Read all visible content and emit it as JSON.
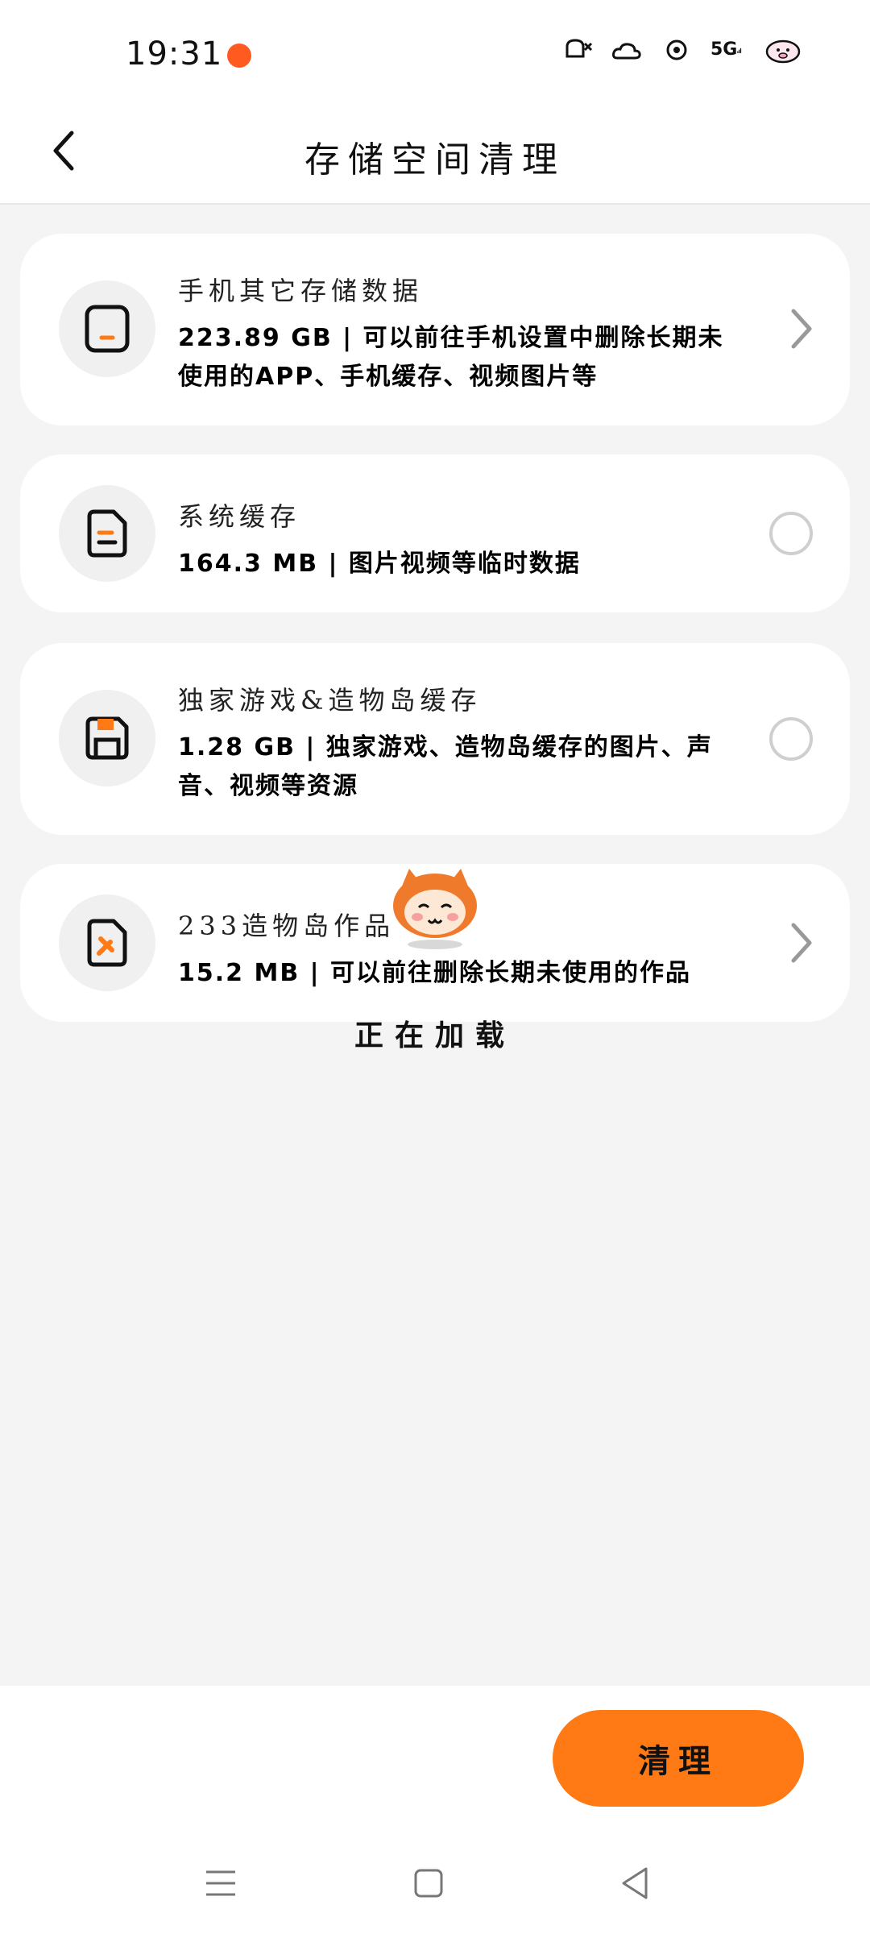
{
  "status_bar": {
    "time": "19:31",
    "network": "5G",
    "icons": [
      "notification-app-icon",
      "mute-icon",
      "weather-icon",
      "settings-icon",
      "signal-icon",
      "battery-pig-icon"
    ]
  },
  "header": {
    "title": "存储空间清理",
    "back_icon": "chevron-left-icon"
  },
  "items": [
    {
      "title": "手机其它存储数据",
      "description": "223.89 GB | 可以前往手机设置中删除长期未使用的APP、手机缓存、视频图片等",
      "icon": "phone-icon",
      "control": "chevron"
    },
    {
      "title": "系统缓存",
      "description": "164.3 MB | 图片视频等临时数据",
      "icon": "document-icon",
      "control": "radio"
    },
    {
      "title": "独家游戏&造物岛缓存",
      "description": "1.28 GB | 独家游戏、造物岛缓存的图片、声音、视频等资源",
      "icon": "save-disk-icon",
      "control": "radio"
    },
    {
      "title": "233造物岛作品",
      "description": "15.2 MB | 可以前往删除长期未使用的作品",
      "icon": "edit-file-icon",
      "control": "chevron"
    }
  ],
  "loading": {
    "text": "正在加载",
    "mascot_icon": "monkey-mascot-icon"
  },
  "actions": {
    "clean_label": "清理"
  },
  "colors": {
    "accent": "#ff7a14",
    "background": "#f4f4f4",
    "card": "#ffffff"
  }
}
